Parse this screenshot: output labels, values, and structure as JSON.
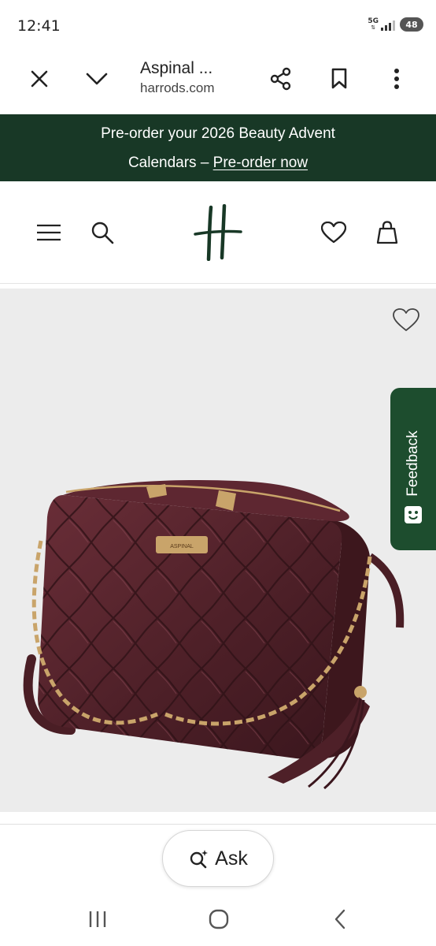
{
  "status_bar": {
    "time": "12:41",
    "network_label": "5G",
    "battery": "48"
  },
  "browser": {
    "tab_title": "Aspinal ...",
    "domain": "harrods.com",
    "icons": [
      "close-icon",
      "chevron-down-icon",
      "share-icon",
      "bookmark-icon",
      "more-vertical-icon"
    ]
  },
  "promo": {
    "line1": "Pre-order your 2026 Beauty Advent",
    "line2_text": "Calendars – ",
    "link": "Pre-order now"
  },
  "site_header": {
    "icons": [
      "menu-icon",
      "search-icon",
      "harrods-logo",
      "heart-icon",
      "shopping-bag-icon"
    ]
  },
  "product": {
    "image_description_icon": "quilted-crossbody-bag",
    "plaque_text": "ASPINAL",
    "bag_color": "#4e2028"
  },
  "feedback": {
    "label": "Feedback"
  },
  "ask": {
    "label": "Ask"
  },
  "colors": {
    "brand_green": "#183826",
    "feedback_green": "#1d4d2e"
  }
}
